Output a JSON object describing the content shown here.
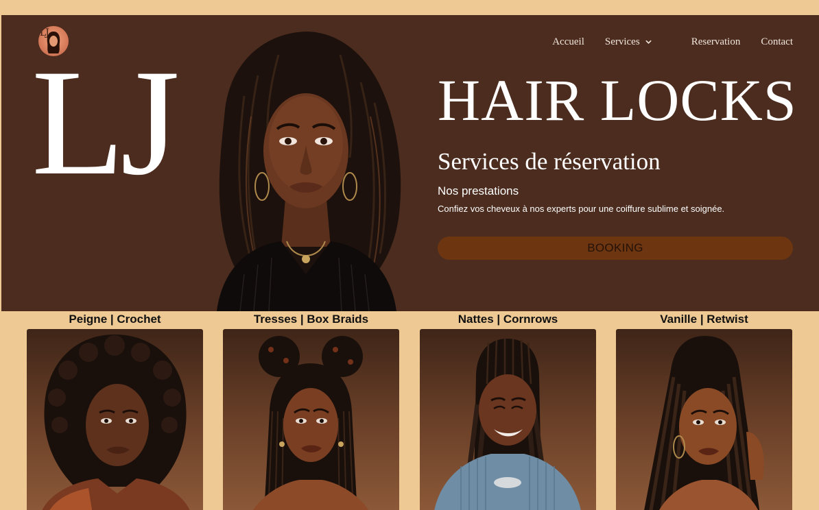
{
  "brand": {
    "logo_text": "LJ",
    "monogram": "LJ"
  },
  "nav": {
    "items": [
      {
        "label": "Accueil"
      },
      {
        "label": "Services",
        "icon": "chevron-down-icon"
      },
      {
        "label": "Reservation"
      },
      {
        "label": "Contact"
      }
    ]
  },
  "hero": {
    "title": "HAIR LOCKS",
    "subtitle": "Services de réservation",
    "prestations_title": "Nos prestations",
    "prestations_text": "Confiez vos cheveux à nos experts pour une coiffure sublime et soignée.",
    "booking_label": "BOOKING"
  },
  "services": [
    {
      "label": "Peigne | Crochet"
    },
    {
      "label": "Tresses | Box Braids"
    },
    {
      "label": "Nattes | Cornrows"
    },
    {
      "label": "Vanille | Retwist"
    }
  ],
  "colors": {
    "page_background": "#efc994",
    "hero_background": "#4b2c1e",
    "booking_button": "#6d3611",
    "hero_text": "#ffffff"
  }
}
